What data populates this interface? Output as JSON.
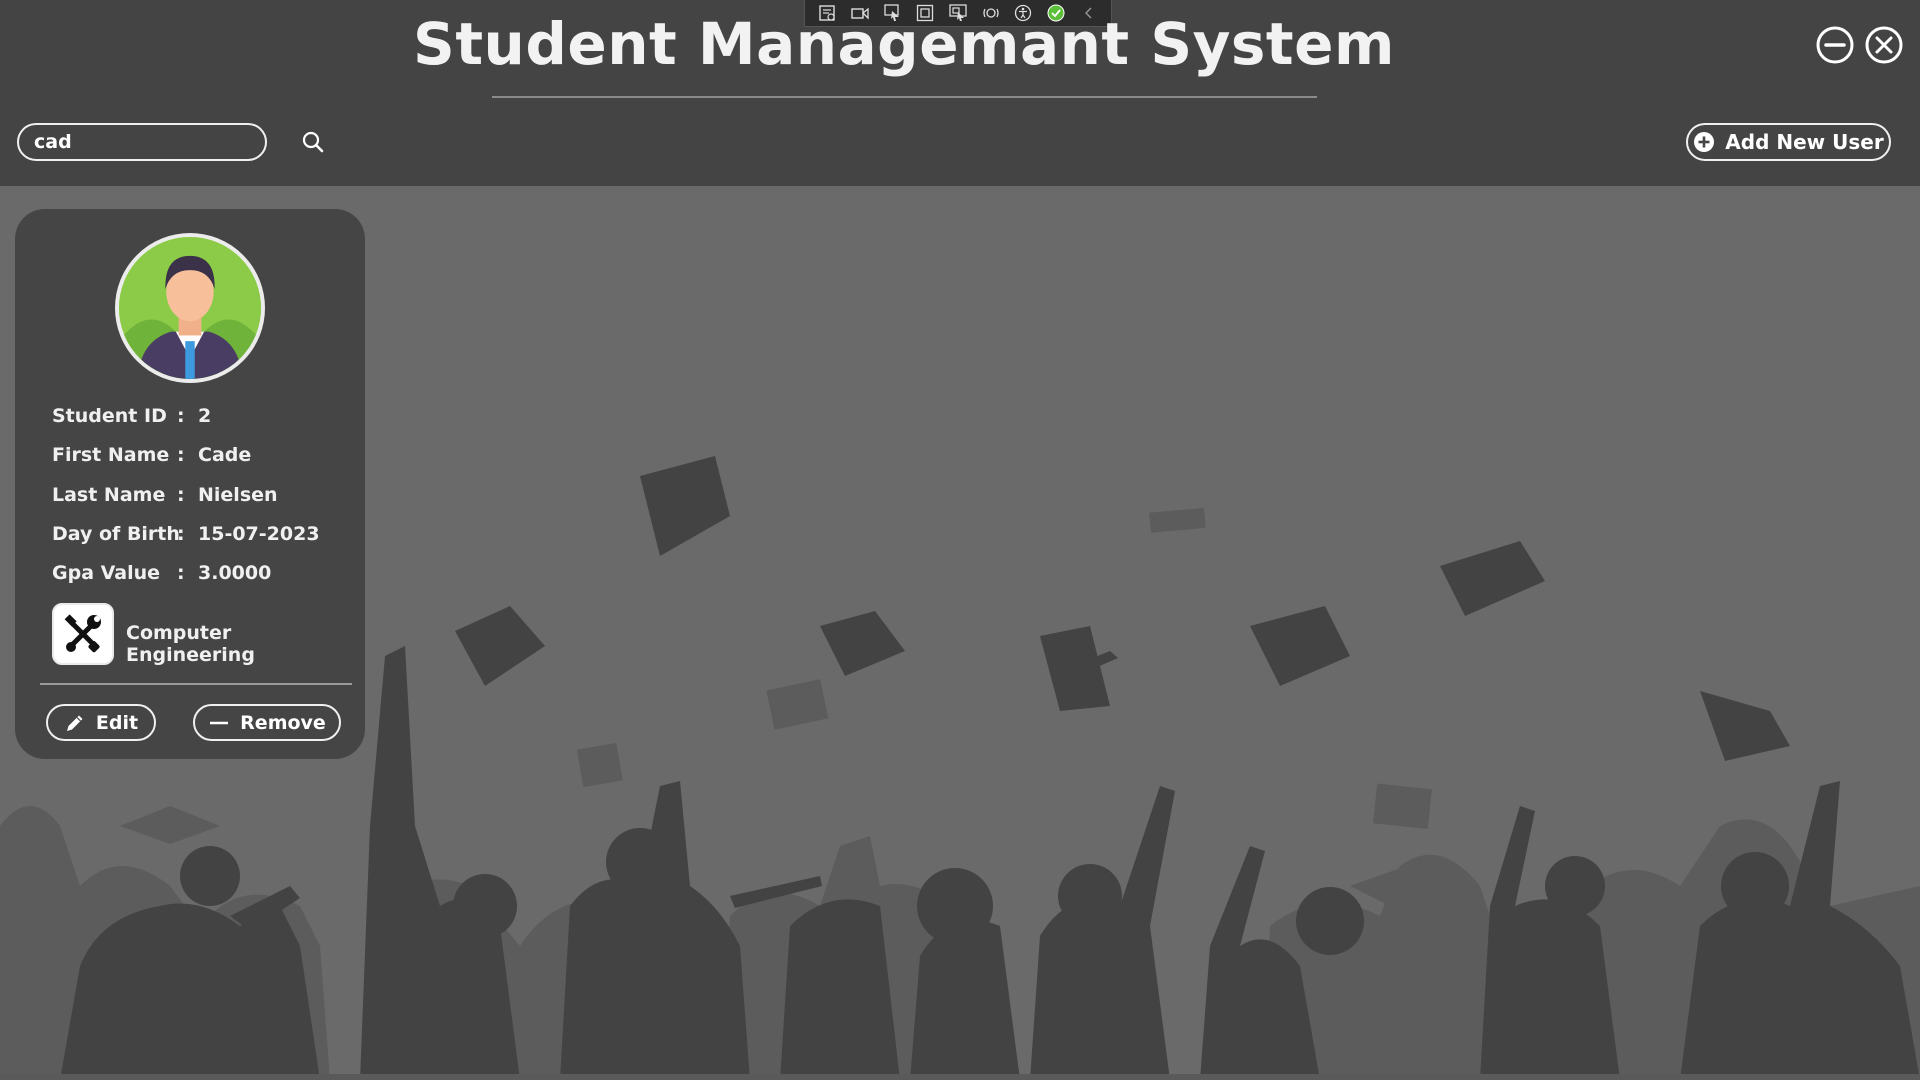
{
  "app": {
    "title": "Student Managemant System"
  },
  "window_controls": {
    "minimize_icon": "minus-circle-icon",
    "close_icon": "x-circle-icon"
  },
  "debug_toolbar": {
    "icons": [
      "live-visual-tree-icon",
      "video-icon",
      "select-element-icon",
      "layout-adorners-icon",
      "track-focus-icon",
      "binding-failures-icon",
      "accessibility-icon",
      "check-circle-icon",
      "chevron-left-icon"
    ]
  },
  "search": {
    "value": "cad",
    "placeholder": ""
  },
  "actions": {
    "add_user_label": "Add New User"
  },
  "student_card": {
    "fields": [
      {
        "label": "Student ID",
        "sep": ":",
        "value": "2"
      },
      {
        "label": "First Name",
        "sep": ":",
        "value": "Cade"
      },
      {
        "label": "Last Name",
        "sep": ":",
        "value": "Nielsen"
      },
      {
        "label": "Day of Birth",
        "sep": ":",
        "value": "15-07-2023"
      },
      {
        "label": "Gpa Value",
        "sep": ":",
        "value": "3.0000"
      }
    ],
    "department": "Computer Engineering",
    "department_icon": "tools-icon",
    "edit_label": "Edit",
    "remove_label": "Remove"
  },
  "colors": {
    "header_bg": "#444444",
    "page_bg": "#6a6a6a",
    "card_bg": "#454545",
    "silhouette_dark": "#434343",
    "silhouette_light": "#5c5c5c",
    "accent_green": "#8ccb48"
  }
}
